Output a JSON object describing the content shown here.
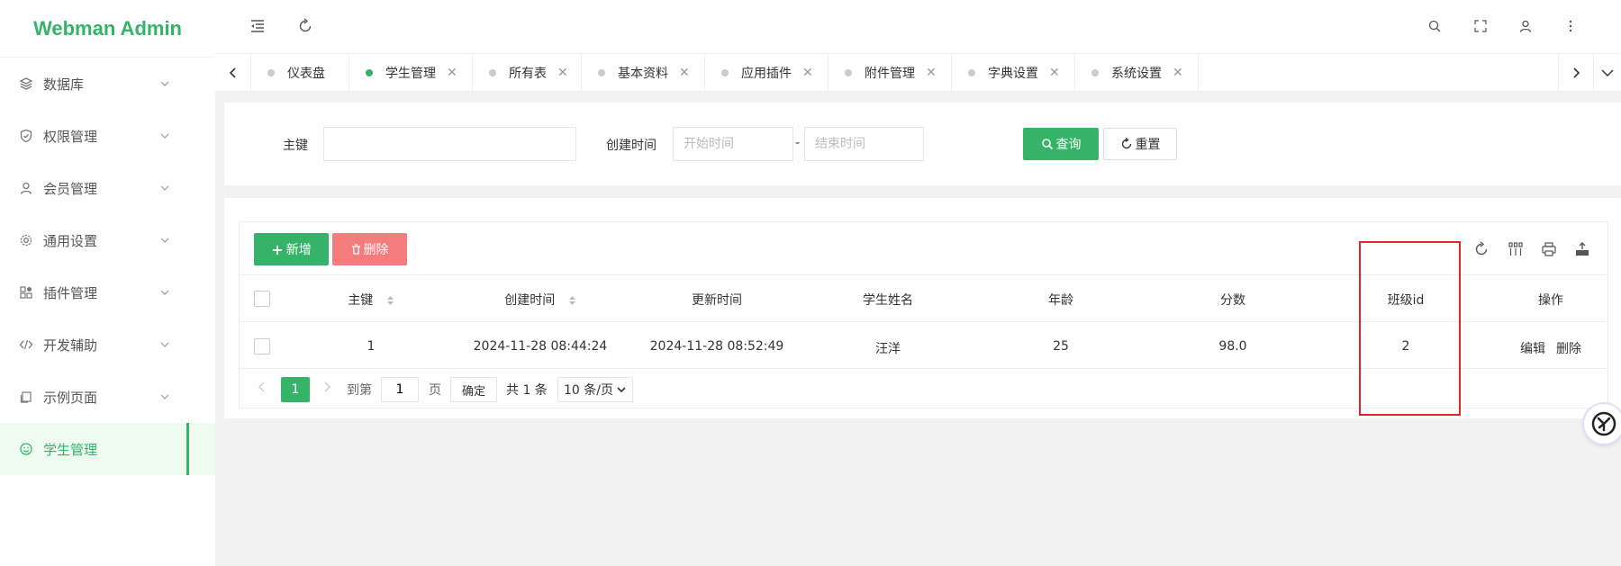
{
  "brand": "Webman Admin",
  "sidebar": {
    "items": [
      {
        "label": "数据库",
        "icon": "layers-icon"
      },
      {
        "label": "权限管理",
        "icon": "shield-check-icon"
      },
      {
        "label": "会员管理",
        "icon": "user-icon"
      },
      {
        "label": "通用设置",
        "icon": "gear-icon"
      },
      {
        "label": "插件管理",
        "icon": "apps-icon"
      },
      {
        "label": "开发辅助",
        "icon": "code-icon"
      },
      {
        "label": "示例页面",
        "icon": "page-icon"
      },
      {
        "label": "学生管理",
        "icon": "smile-icon",
        "active": true
      }
    ]
  },
  "tabs": [
    {
      "label": "仪表盘",
      "closable": false
    },
    {
      "label": "学生管理",
      "closable": true,
      "active": true
    },
    {
      "label": "所有表",
      "closable": true
    },
    {
      "label": "基本资料",
      "closable": true
    },
    {
      "label": "应用插件",
      "closable": true
    },
    {
      "label": "附件管理",
      "closable": true
    },
    {
      "label": "字典设置",
      "closable": true
    },
    {
      "label": "系统设置",
      "closable": true
    }
  ],
  "search": {
    "pk_label": "主键",
    "pk_value": "",
    "created_label": "创建时间",
    "start_placeholder": "开始时间",
    "range_sep": "-",
    "end_placeholder": "结束时间",
    "query_label": "查询",
    "reset_label": "重置"
  },
  "toolbar": {
    "add_label": "新增",
    "delete_label": "删除"
  },
  "table": {
    "columns": [
      "主键",
      "创建时间",
      "更新时间",
      "学生姓名",
      "年龄",
      "分数",
      "班级id",
      "操作"
    ],
    "rows": [
      {
        "id": "1",
        "created": "2024-11-28 08:44:24",
        "updated": "2024-11-28 08:52:49",
        "name": "汪洋",
        "age": "25",
        "score": "98.0",
        "class_id": "2",
        "edit": "编辑",
        "del": "删除"
      }
    ]
  },
  "pager": {
    "current": "1",
    "goto_label": "到第",
    "goto_value": "1",
    "page_unit": "页",
    "confirm": "确定",
    "total": "共 1 条",
    "page_size": "10 条/页"
  },
  "colors": {
    "accent": "#36b368",
    "danger": "#f57c7c",
    "highlight": "#d9272e"
  }
}
